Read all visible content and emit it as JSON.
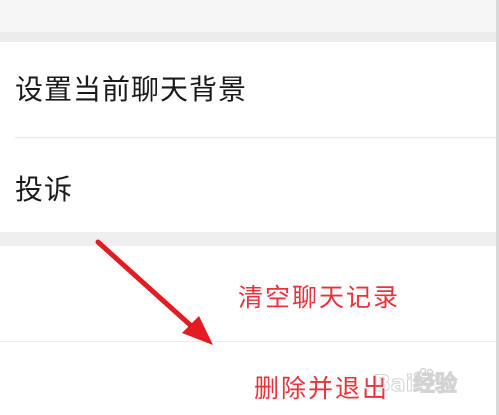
{
  "settings": {
    "set_background_label": "设置当前聊天背景",
    "complain_label": "投诉"
  },
  "actions": {
    "clear_history_label": "清空聊天记录",
    "delete_exit_label": "删除并退出"
  },
  "colors": {
    "action_red": "#e8323c",
    "arrow_red": "#e31b23",
    "text_dark": "#1a1a1a",
    "separator_gray": "#efefef"
  },
  "annotation": {
    "icon": "arrow-pointer-icon"
  },
  "watermark": {
    "icon": "baidu-paw-logo-icon",
    "text": "Bai经验"
  }
}
